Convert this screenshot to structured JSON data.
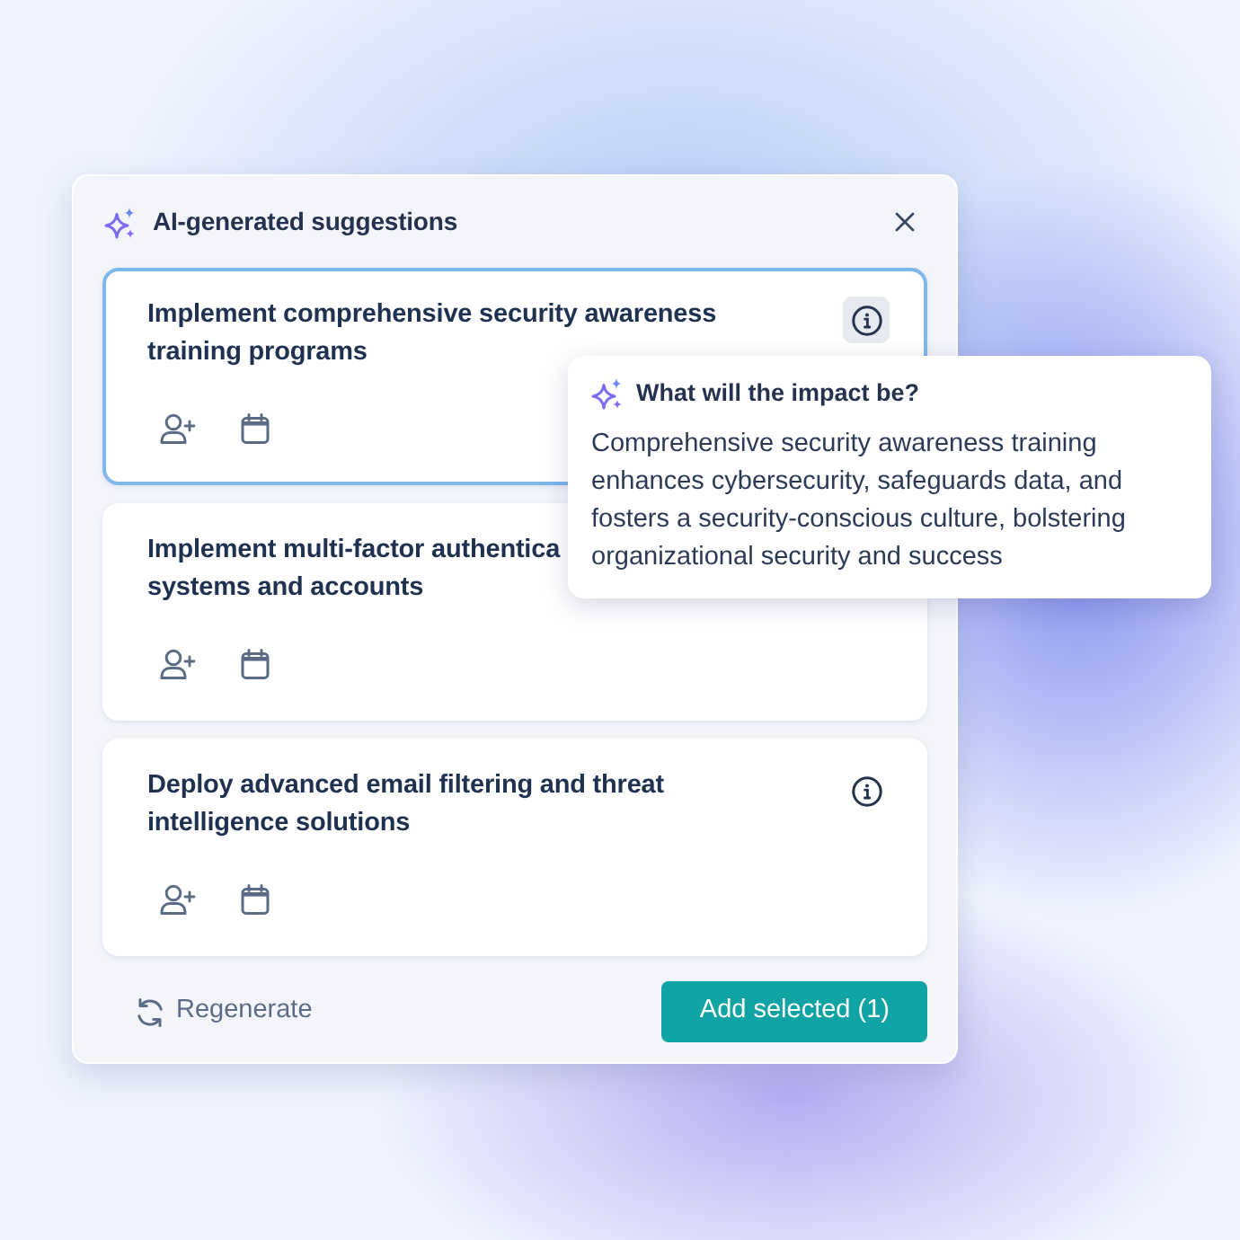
{
  "panel": {
    "title": "AI-generated suggestions"
  },
  "suggestions": [
    {
      "title": "Implement comprehensive security awareness\ntraining programs",
      "selected": true,
      "info": {
        "active": true
      }
    },
    {
      "title": "Implement multi-factor authentica\nsystems and accounts",
      "selected": false
    },
    {
      "title": "Deploy advanced email filtering and threat\nintelligence solutions",
      "selected": false,
      "info": {
        "active": false
      }
    }
  ],
  "tooltip": {
    "title": "What will the impact be?",
    "text": "Comprehensive security awareness training enhances cybersecurity, safeguards data, and fosters a security-conscious culture, bolstering organizational security and success"
  },
  "footer": {
    "regenerate": "Regenerate",
    "add_button": "Add selected (1)"
  }
}
